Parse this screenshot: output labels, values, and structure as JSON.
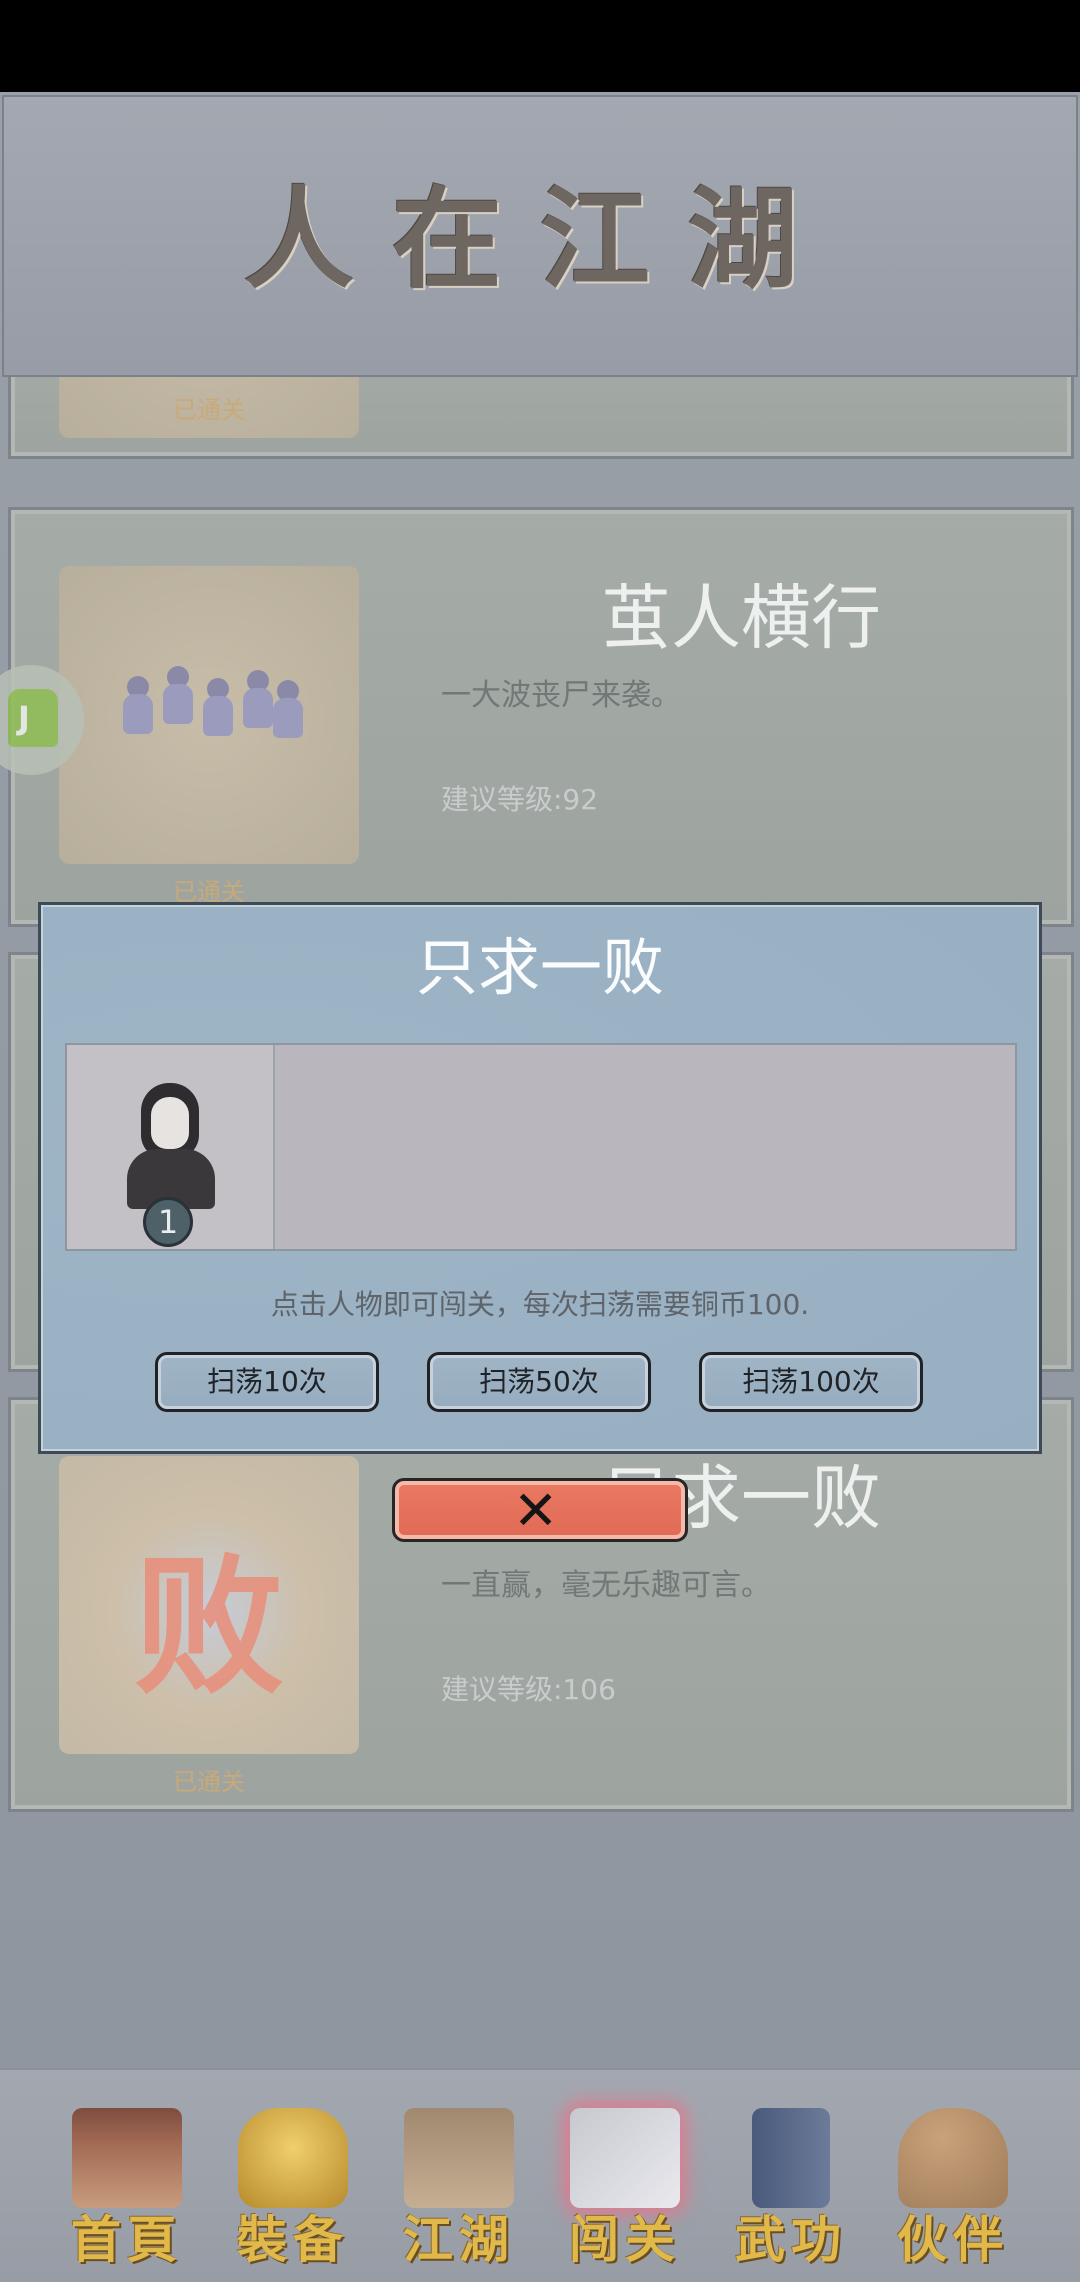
{
  "header": {
    "title": "人在江湖"
  },
  "levels": [
    {
      "name": "",
      "desc": "",
      "level": "",
      "status": "已通关"
    },
    {
      "name": "茧人横行",
      "desc": "一大波丧尸来袭。",
      "level": "建议等级:92",
      "status": "已通关"
    },
    {
      "name": "只求一败",
      "desc": "一直赢，毫无乐趣可言。",
      "level": "建议等级:106",
      "status": "已通关",
      "thumb_glyph": "败"
    }
  ],
  "floating_debug": {
    "label": "J"
  },
  "modal": {
    "title": "只求一败",
    "hero_badge": "1",
    "tip": "点击人物即可闯关，每次扫荡需要铜币100.",
    "buttons": [
      "扫荡10次",
      "扫荡50次",
      "扫荡100次"
    ],
    "close_icon": "close-icon"
  },
  "tabs": [
    {
      "label": "首頁",
      "icon": "home-icon"
    },
    {
      "label": "裝备",
      "icon": "armor-icon"
    },
    {
      "label": "江湖",
      "icon": "map-scroll-icon"
    },
    {
      "label": "闯关",
      "icon": "crossed-swords-icon",
      "active": true
    },
    {
      "label": "武功",
      "icon": "book-icon"
    },
    {
      "label": "伙伴",
      "icon": "partners-icon"
    }
  ],
  "colors": {
    "accent_gold": "#e0b94a",
    "modal_bg": "#9ab2c4",
    "close_red": "#e06a55"
  }
}
